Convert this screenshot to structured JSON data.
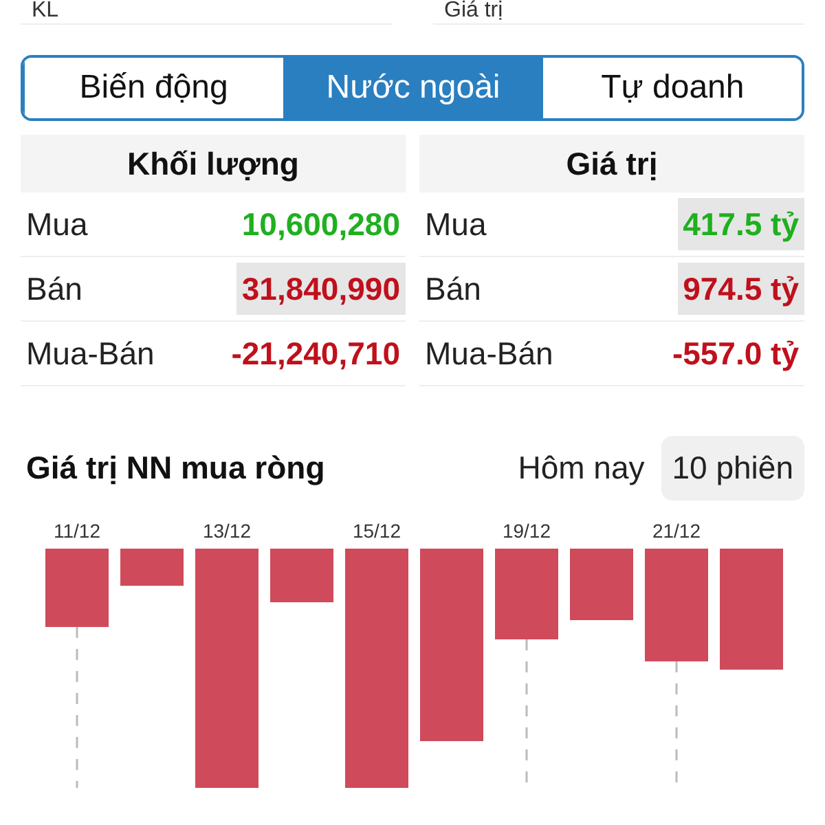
{
  "summary": {
    "labels": [
      "KL",
      "Giá trị"
    ]
  },
  "tabs": [
    {
      "label": "Biến động",
      "selected": false
    },
    {
      "label": "Nước ngoài",
      "selected": true
    },
    {
      "label": "Tự doanh",
      "selected": false
    }
  ],
  "tables": [
    {
      "title": "Khối lượng",
      "rows": [
        {
          "label": "Mua",
          "value": "10,600,280",
          "color": "#1fb01f",
          "highlighted": false
        },
        {
          "label": "Bán",
          "value": "31,840,990",
          "color": "#c0101c",
          "highlighted": true
        },
        {
          "label": "Mua-Bán",
          "value": "-21,240,710",
          "color": "#c0101c",
          "highlighted": false
        }
      ]
    },
    {
      "title": "Giá trị",
      "rows": [
        {
          "label": "Mua",
          "value": "417.5 tỷ",
          "color": "#1fb01f",
          "highlighted": true
        },
        {
          "label": "Bán",
          "value": "974.5 tỷ",
          "color": "#c0101c",
          "highlighted": true
        },
        {
          "label": "Mua-Bán",
          "value": "-557.0 tỷ",
          "color": "#c0101c",
          "highlighted": false
        }
      ]
    }
  ],
  "chart": {
    "title": "Giá trị NN mua ròng",
    "ranges": [
      {
        "label": "Hôm nay",
        "selected": false
      },
      {
        "label": "10 phiên",
        "selected": true
      }
    ],
    "date_labels": [
      "11/12",
      "13/12",
      "15/12",
      "19/12",
      "21/12"
    ]
  }
}
